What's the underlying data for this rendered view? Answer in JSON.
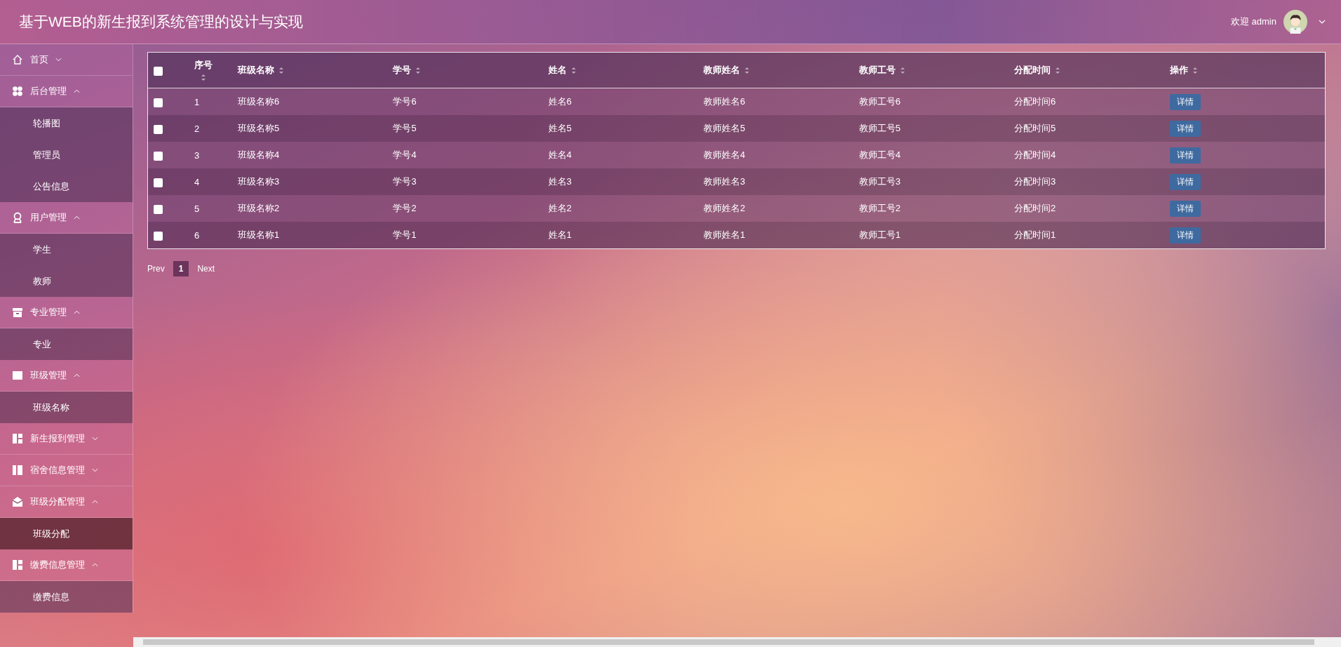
{
  "header": {
    "title": "基于WEB的新生报到系统管理的设计与实现",
    "welcome": "欢迎 admin"
  },
  "sidebar": {
    "items": [
      {
        "label": "首页",
        "expanded": false
      },
      {
        "label": "后台管理",
        "expanded": true,
        "children": [
          {
            "label": "轮播图",
            "selected": false
          },
          {
            "label": "管理员",
            "selected": false
          },
          {
            "label": "公告信息",
            "selected": false
          }
        ]
      },
      {
        "label": "用户管理",
        "expanded": true,
        "children": [
          {
            "label": "学生",
            "selected": false
          },
          {
            "label": "教师",
            "selected": false
          }
        ]
      },
      {
        "label": "专业管理",
        "expanded": true,
        "children": [
          {
            "label": "专业",
            "selected": false
          }
        ]
      },
      {
        "label": "班级管理",
        "expanded": true,
        "children": [
          {
            "label": "班级名称",
            "selected": false
          }
        ]
      },
      {
        "label": "新生报到管理",
        "expanded": false
      },
      {
        "label": "宿舍信息管理",
        "expanded": false
      },
      {
        "label": "班级分配管理",
        "expanded": true,
        "children": [
          {
            "label": "班级分配",
            "selected": true
          }
        ]
      },
      {
        "label": "缴费信息管理",
        "expanded": true,
        "children": [
          {
            "label": "缴费信息",
            "selected": false
          }
        ]
      }
    ]
  },
  "table": {
    "columns": [
      "序号",
      "班级名称",
      "学号",
      "姓名",
      "教师姓名",
      "教师工号",
      "分配时间",
      "操作"
    ],
    "rows": [
      {
        "checked": false,
        "cells": [
          "1",
          "班级名称6",
          "学号6",
          "姓名6",
          "教师姓名6",
          "教师工号6",
          "分配时间6"
        ],
        "action": "详情"
      },
      {
        "checked": false,
        "cells": [
          "2",
          "班级名称5",
          "学号5",
          "姓名5",
          "教师姓名5",
          "教师工号5",
          "分配时间5"
        ],
        "action": "详情"
      },
      {
        "checked": false,
        "cells": [
          "3",
          "班级名称4",
          "学号4",
          "姓名4",
          "教师姓名4",
          "教师工号4",
          "分配时间4"
        ],
        "action": "详情"
      },
      {
        "checked": false,
        "cells": [
          "4",
          "班级名称3",
          "学号3",
          "姓名3",
          "教师姓名3",
          "教师工号3",
          "分配时间3"
        ],
        "action": "详情"
      },
      {
        "checked": false,
        "cells": [
          "5",
          "班级名称2",
          "学号2",
          "姓名2",
          "教师姓名2",
          "教师工号2",
          "分配时间2"
        ],
        "action": "详情"
      },
      {
        "checked": false,
        "cells": [
          "6",
          "班级名称1",
          "学号1",
          "姓名1",
          "教师姓名1",
          "教师工号1",
          "分配时间1"
        ],
        "action": "详情"
      }
    ],
    "select_all_checked": false
  },
  "pagination": {
    "prev": "Prev",
    "pages": [
      {
        "label": "1",
        "selected": true
      }
    ],
    "next": "Next"
  }
}
